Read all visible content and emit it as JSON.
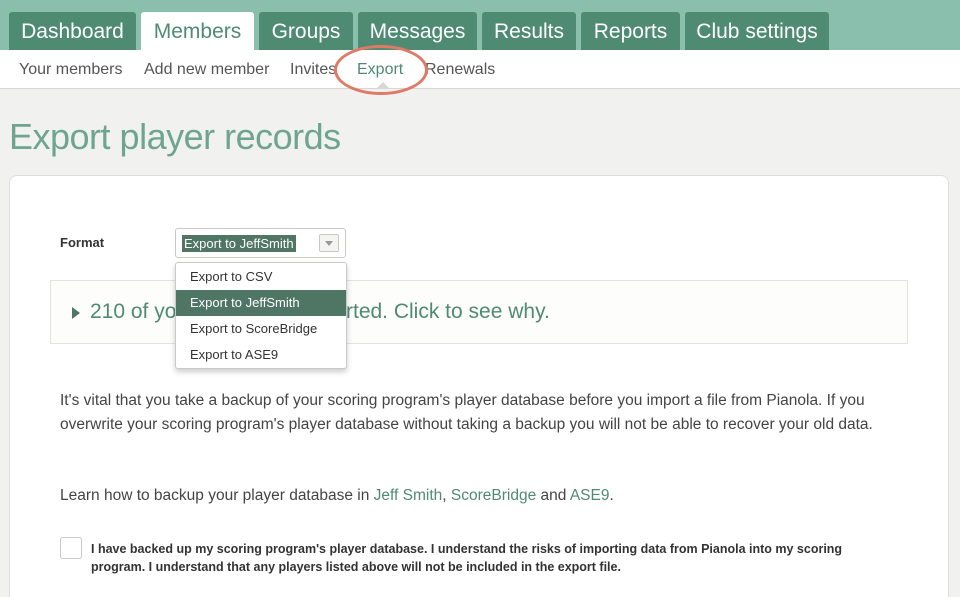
{
  "nav": {
    "tabs": [
      "Dashboard",
      "Members",
      "Groups",
      "Messages",
      "Results",
      "Reports",
      "Club settings"
    ],
    "active": "Members"
  },
  "subnav": {
    "items": [
      "Your members",
      "Add new member",
      "Invites",
      "Export",
      "Renewals"
    ],
    "active": "Export"
  },
  "page": {
    "title": "Export player records"
  },
  "form": {
    "format_label": "Format",
    "selected": "Export to JeffSmith",
    "options": [
      "Export to CSV",
      "Export to JeffSmith",
      "Export to ScoreBridge",
      "Export to ASE9"
    ]
  },
  "warning": {
    "visible_start": "210 of yo",
    "visible_end": "ill not be exported. Click to see why."
  },
  "body": {
    "backup_text": "It's vital that you take a backup of your scoring program's player database before you import a file from Pianola. If you overwrite your scoring program's player database without taking a backup you will not be able to recover your old data.",
    "learn_prefix": "Learn how to backup your player database in ",
    "learn_link1": "Jeff Smith",
    "learn_sep1": ", ",
    "learn_link2": "ScoreBridge",
    "learn_sep2": " and ",
    "learn_link3": "ASE9",
    "learn_end": "."
  },
  "confirm": {
    "label": "I have backed up my scoring program's player database. I understand the risks of importing data from Pianola into my scoring program. I understand that any players listed above will not be included in the export file."
  },
  "colors": {
    "brand": "#4f8b73",
    "nav_bg": "#8bbfad",
    "highlight": "#e07a66"
  }
}
